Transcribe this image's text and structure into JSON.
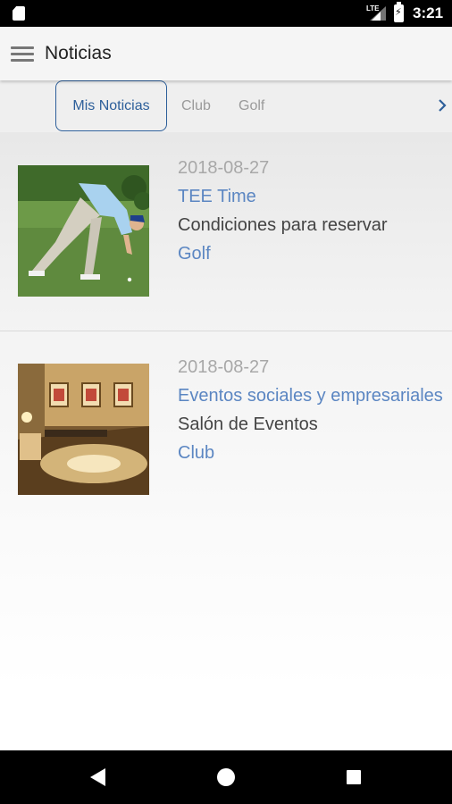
{
  "status_bar": {
    "time": "3:21",
    "network": "LTE",
    "icons": [
      "sd-card-icon",
      "signal-icon",
      "battery-charging-icon"
    ]
  },
  "app_bar": {
    "title": "Noticias",
    "menu_icon": "hamburger-menu-icon"
  },
  "tabs": [
    {
      "label": "Mis Noticias",
      "active": true
    },
    {
      "label": "Club",
      "active": false
    },
    {
      "label": "Golf",
      "active": false
    }
  ],
  "tab_next_icon": "chevron-right-icon",
  "news": [
    {
      "date": "2018-08-27",
      "headline": "TEE Time",
      "subtitle": "Condiciones para reservar",
      "category": "Golf",
      "image": "golfer-photo"
    },
    {
      "date": "2018-08-27",
      "headline": "Eventos sociales y empresariales",
      "subtitle": "Salón de Eventos",
      "category": "Club",
      "image": "event-hall-photo"
    }
  ],
  "nav_bar": {
    "icons": [
      "back-icon",
      "home-icon",
      "recents-icon"
    ]
  },
  "colors": {
    "accent": "#2d5f9a",
    "link": "#5b86c2",
    "status_bar": "#000000",
    "app_bar": "#f5f5f5"
  }
}
